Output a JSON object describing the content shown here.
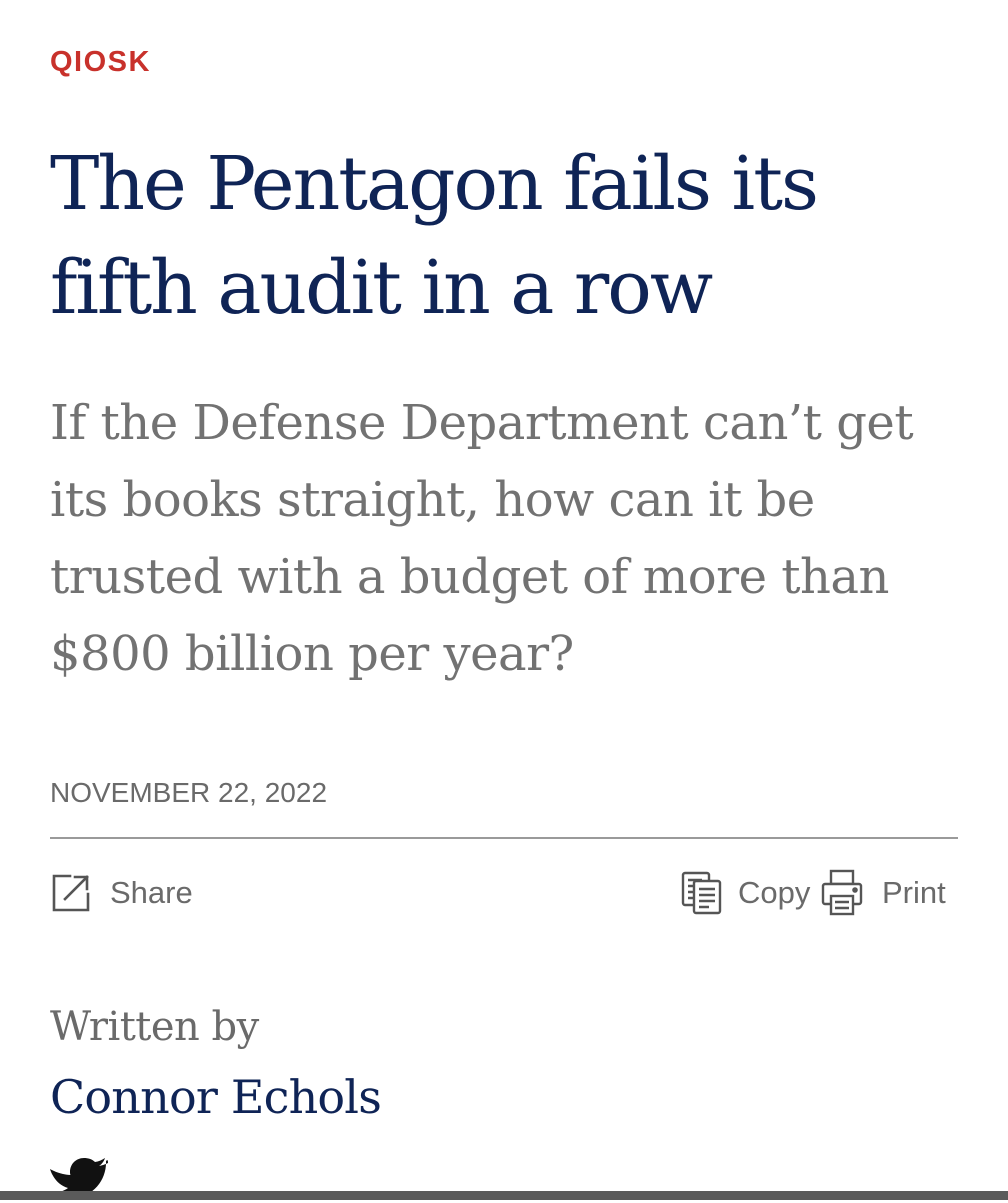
{
  "section": {
    "label": "QIOSK"
  },
  "article": {
    "headline": "The Pentagon fails its fifth audit in a row",
    "dek": "If the Defense Department can’t get its books straight, how can it be trusted with a budget of more than $800 billion per year?",
    "date": "NOVEMBER 22, 2022"
  },
  "actions": {
    "share_label": "Share",
    "copy_label": "Copy",
    "print_label": "Print"
  },
  "byline": {
    "prefix": "Written by",
    "author": "Connor Echols",
    "social_icon": "twitter-icon"
  },
  "colors": {
    "section_red": "#c8312b",
    "headline_navy": "#0f2456",
    "dek_gray": "#727272",
    "meta_gray": "#6a6a6a",
    "divider": "#9a9a9a"
  }
}
